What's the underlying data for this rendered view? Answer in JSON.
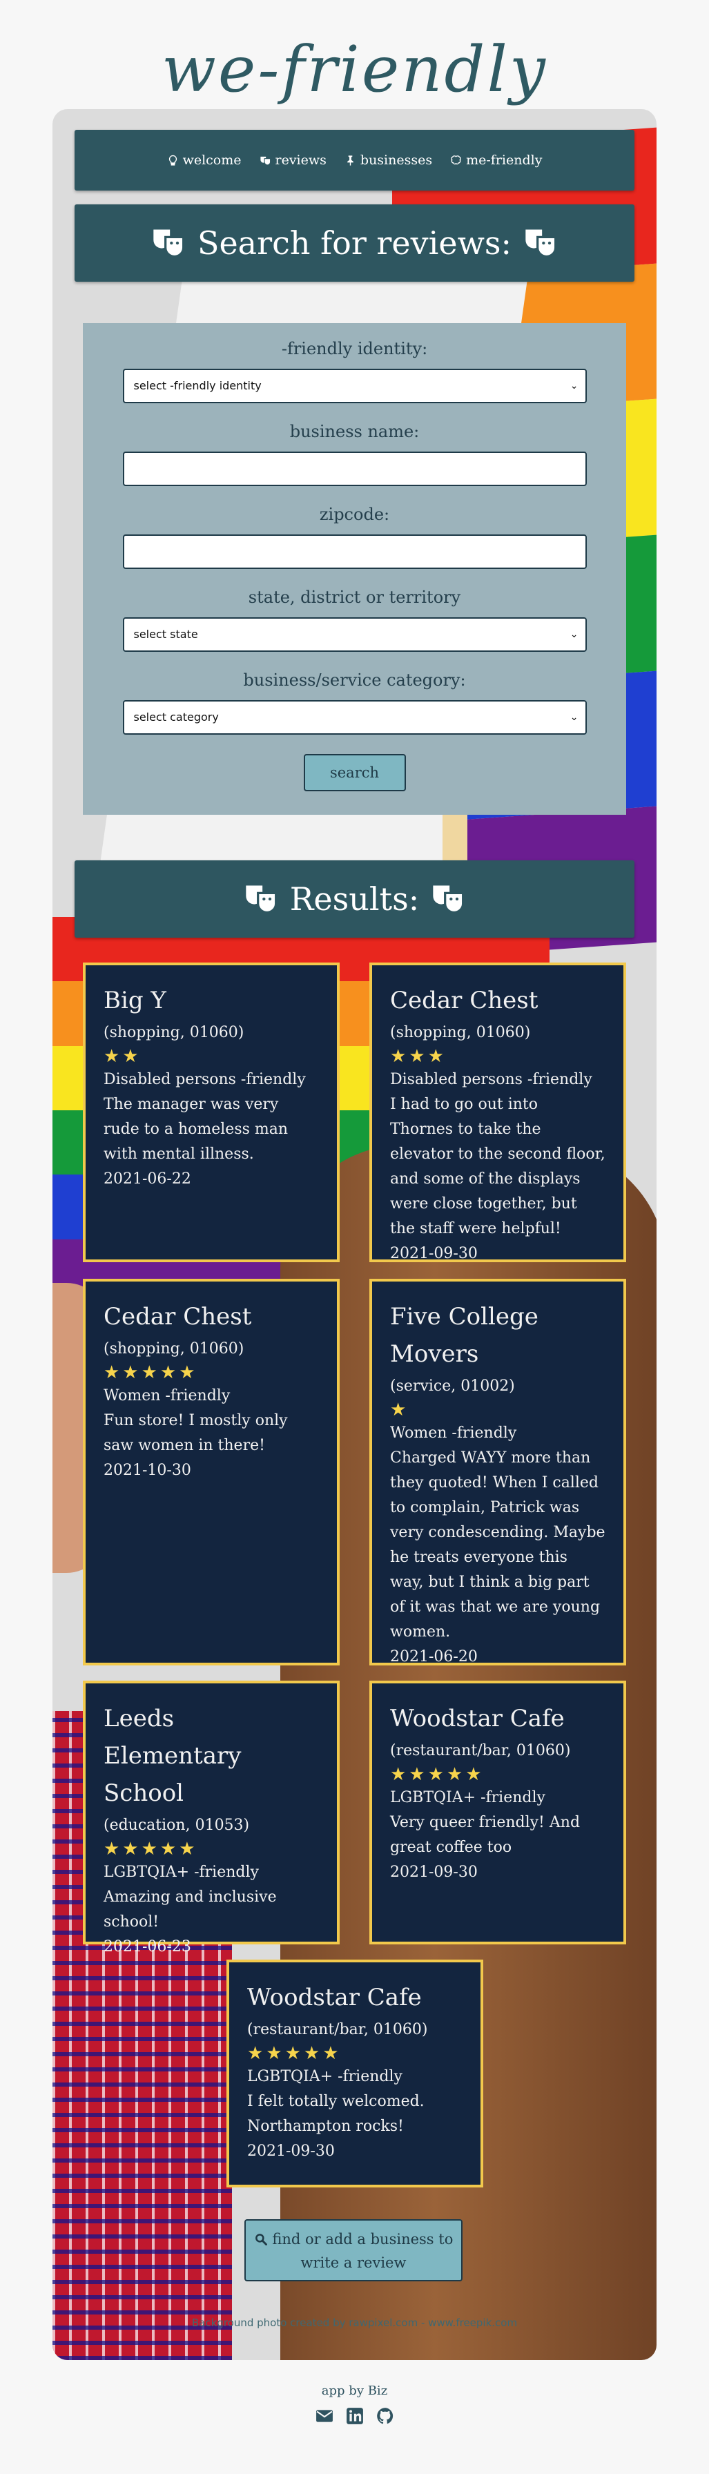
{
  "logo": "we-friendly",
  "nav": [
    {
      "label": "welcome",
      "icon": "lightbulb-icon"
    },
    {
      "label": "reviews",
      "icon": "theater-masks-icon"
    },
    {
      "label": "businesses",
      "icon": "thumbtack-icon"
    },
    {
      "label": "me-friendly",
      "icon": "brain-icon"
    }
  ],
  "search": {
    "heading": "Search for reviews:",
    "identity_label": "-friendly identity:",
    "identity_value": "select -friendly identity",
    "business_label": "business name:",
    "business_value": "",
    "zip_label": "zipcode:",
    "zip_value": "",
    "state_label": "state, district or territory",
    "state_value": "select state",
    "category_label": "business/service category:",
    "category_value": "select category",
    "button": "search"
  },
  "results_heading": "Results:",
  "reviews": [
    {
      "name": "Big Y",
      "meta": "(shopping, 01060)",
      "stars": "★★",
      "rating": 2,
      "identity": "Disabled persons -friendly",
      "text": "The manager was very rude to a homeless man with mental illness.",
      "date": "2021-06-22"
    },
    {
      "name": "Cedar Chest",
      "meta": "(shopping, 01060)",
      "stars": "★★★",
      "rating": 3,
      "identity": "Disabled persons -friendly",
      "text": "I had to go out into Thornes to take the elevator to the second floor, and some of the displays were close together, but the staff were helpful!",
      "date": "2021-09-30"
    },
    {
      "name": "Cedar Chest",
      "meta": "(shopping, 01060)",
      "stars": "★★★★★",
      "rating": 5,
      "identity": "Women -friendly",
      "text": "Fun store! I mostly only saw women in there!",
      "date": "2021-10-30"
    },
    {
      "name": "Five College Movers",
      "meta": "(service, 01002)",
      "stars": "★",
      "rating": 1,
      "identity": "Women -friendly",
      "text": "Charged WAYY more than they quoted! When I called to complain, Patrick was very condescending. Maybe he treats everyone this way, but I think a big part of it was that we are young women.",
      "date": "2021-06-20"
    },
    {
      "name": "Leeds Elementary School",
      "meta": "(education, 01053)",
      "stars": "★★★★★",
      "rating": 5,
      "identity": "LGBTQIA+ -friendly",
      "text": "Amazing and inclusive school!",
      "date": "2021-06-23"
    },
    {
      "name": "Woodstar Cafe",
      "meta": "(restaurant/bar, 01060)",
      "stars": "★★★★★",
      "rating": 5,
      "identity": "LGBTQIA+ -friendly",
      "text": "Very queer friendly! And great coffee too",
      "date": "2021-09-30"
    },
    {
      "name": "Woodstar Cafe",
      "meta": "(restaurant/bar, 01060)",
      "stars": "★★★★★",
      "rating": 5,
      "identity": "LGBTQIA+ -friendly",
      "text": "I felt totally welcomed. Northampton rocks!",
      "date": "2021-09-30"
    }
  ],
  "add_button": "find or add a business to write a review",
  "credit": "Background photo created by rawpixel.com - www.freepik.com",
  "footer": {
    "text": "app by Biz",
    "icons": [
      "envelope-icon",
      "linkedin-icon",
      "github-icon"
    ]
  },
  "colors": {
    "panel": "#2e5660",
    "form": "#9cb3bb",
    "review_bg": "#13253f",
    "review_border": "#f2c94c",
    "star": "#f7d44c",
    "button": "#7fb7c2"
  }
}
